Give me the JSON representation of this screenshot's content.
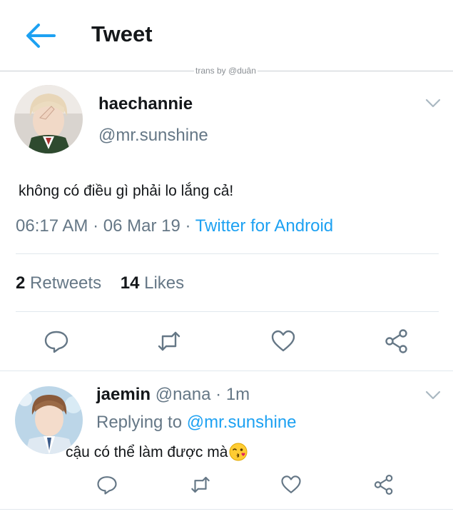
{
  "header": {
    "title": "Tweet",
    "watermark": "trans by @duân"
  },
  "tweet": {
    "display_name": "haechannie",
    "handle": "@mr.sunshine",
    "text": "không có điều gì phải lo lắng cả!",
    "time": "06:17 AM",
    "date": "06 Mar 19",
    "source": "Twitter for Android",
    "retweets_count": "2",
    "retweets_label": "Retweets",
    "likes_count": "14",
    "likes_label": "Likes"
  },
  "reply": {
    "display_name": "jaemin",
    "handle": "@nana",
    "age": "1m",
    "replying_label": "Replying to",
    "replying_to": "@mr.sunshine",
    "text": "cậu có thể làm được mà"
  },
  "icons": {
    "back": "arrow-left-icon",
    "more": "chevron-down-icon",
    "reply": "reply-icon",
    "retweet": "retweet-icon",
    "like": "heart-icon",
    "share": "share-icon",
    "emoji": "kissing-wink-emoji"
  },
  "colors": {
    "accent": "#1da1f2",
    "secondary_text": "#657786",
    "primary_text": "#14171a",
    "divider": "#e1e8ed"
  }
}
